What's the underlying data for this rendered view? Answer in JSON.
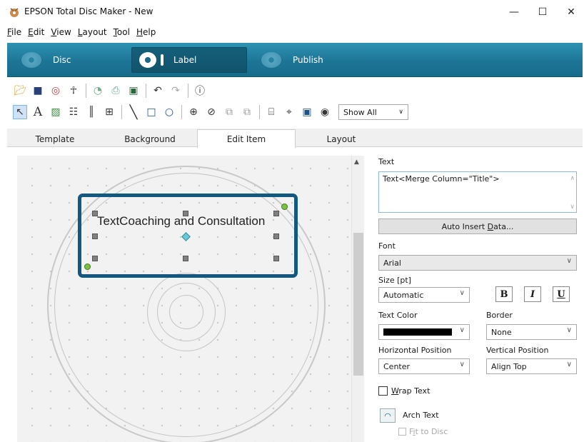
{
  "window": {
    "title": "EPSON Total Disc Maker - New",
    "minimize": "—",
    "maximize": "☐",
    "close": "✕"
  },
  "menu": [
    {
      "u": "F",
      "rest": "ile"
    },
    {
      "u": "E",
      "rest": "dit"
    },
    {
      "u": "V",
      "rest": "iew"
    },
    {
      "u": "L",
      "rest": "ayout"
    },
    {
      "u": "T",
      "rest": "ool"
    },
    {
      "u": "H",
      "rest": "elp"
    }
  ],
  "modes": {
    "disc": "Disc",
    "label": "Label",
    "publish": "Publish"
  },
  "toolbar2": {
    "show_all": "Show All"
  },
  "tabs": {
    "template": "Template",
    "background": "Background",
    "edit_item": "Edit Item",
    "layout": "Layout"
  },
  "canvas": {
    "text_item": "TextCoaching and Consultation"
  },
  "panel": {
    "text_label": "Text",
    "text_value": "Text<Merge Column=\"Title\">",
    "auto_insert_prefix": "Auto Insert ",
    "auto_insert_u": "D",
    "auto_insert_suffix": "ata...",
    "font_label": "Font",
    "font_value": "Arial",
    "size_label": "Size [pt]",
    "size_value": "Automatic",
    "bold": "B",
    "italic": "I",
    "underline": "U",
    "text_color_label": "Text Color",
    "text_color": "#000000",
    "border_label": "Border",
    "border_value": "None",
    "hpos_label": "Horizontal Position",
    "hpos_value": "Center",
    "vpos_label": "Vertical Position",
    "vpos_value": "Align Top",
    "wrap_u": "W",
    "wrap_rest": "rap Text",
    "arch_text": "Arch Text",
    "fit_prefix": "F",
    "fit_u": "i",
    "fit_rest": "t to Disc"
  },
  "colors": {
    "accent": "#1d7596",
    "selection_border": "#13587f"
  }
}
